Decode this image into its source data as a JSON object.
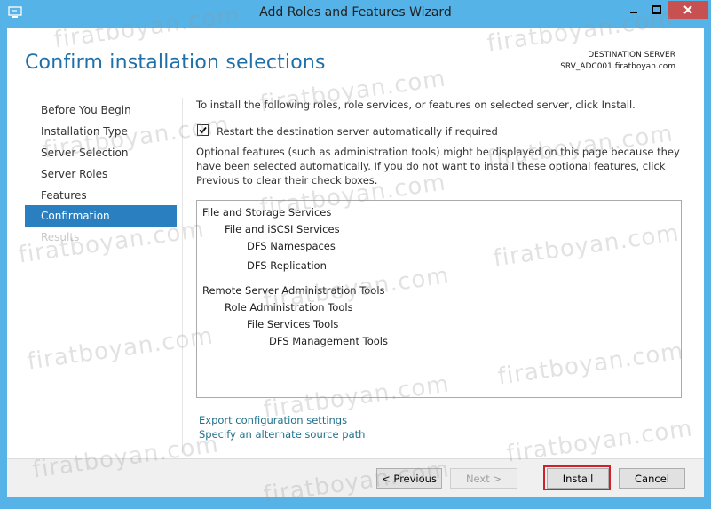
{
  "window": {
    "title": "Add Roles and Features Wizard"
  },
  "page": {
    "title": "Confirm installation selections"
  },
  "destination": {
    "label": "DESTINATION SERVER",
    "server": "SRV_ADC001.firatboyan.com"
  },
  "nav": {
    "items": [
      {
        "label": "Before You Begin"
      },
      {
        "label": "Installation Type"
      },
      {
        "label": "Server Selection"
      },
      {
        "label": "Server Roles"
      },
      {
        "label": "Features"
      },
      {
        "label": "Confirmation"
      },
      {
        "label": "Results"
      }
    ]
  },
  "content": {
    "intro": "To install the following roles, role services, or features on selected server, click Install.",
    "restart_label": "Restart the destination server automatically if required",
    "restart_checked": true,
    "note": "Optional features (such as administration tools) might be displayed on this page because they have been selected automatically. If you do not want to install these optional features, click Previous to clear their check boxes.",
    "tree": [
      {
        "label": "File and Storage Services",
        "level": 0
      },
      {
        "label": "File and iSCSI Services",
        "level": 1
      },
      {
        "label": "DFS Namespaces",
        "level": 2
      },
      {
        "label": "DFS Replication",
        "level": 2
      },
      {
        "label": "Remote Server Administration Tools",
        "level": 0
      },
      {
        "label": "Role Administration Tools",
        "level": 1
      },
      {
        "label": "File Services Tools",
        "level": 2
      },
      {
        "label": "DFS Management Tools",
        "level": 3
      }
    ],
    "links": {
      "export": "Export configuration settings",
      "alternate": "Specify an alternate source path"
    }
  },
  "buttons": {
    "previous": "< Previous",
    "next": "Next >",
    "install": "Install",
    "cancel": "Cancel"
  },
  "watermark": "firatboyan.com",
  "colors": {
    "accent": "#2a7fc0",
    "titlebar": "#55b3e7",
    "highlight": "#d0202a"
  }
}
